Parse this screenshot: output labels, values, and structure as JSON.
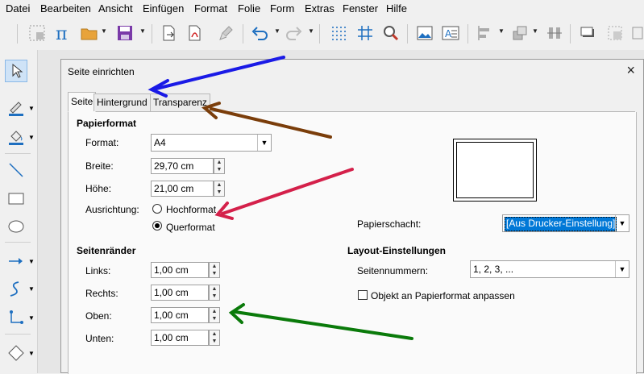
{
  "menu": [
    "Datei",
    "Bearbeiten",
    "Ansicht",
    "Einfügen",
    "Format",
    "Folie",
    "Form",
    "Extras",
    "Fenster",
    "Hilfe"
  ],
  "dialog": {
    "title": "Seite einrichten",
    "close": "×",
    "tabs": [
      "Seite",
      "Hintergrund",
      "Transparenz"
    ],
    "paper": {
      "heading": "Papierformat",
      "format_label": "Format:",
      "format_value": "A4",
      "width_label": "Breite:",
      "width_value": "29,70 cm",
      "height_label": "Höhe:",
      "height_value": "21,00 cm",
      "orientation_label": "Ausrichtung:",
      "portrait": "Hochformat",
      "landscape": "Querformat",
      "tray_label": "Papierschacht:",
      "tray_value": "[Aus Drucker-Einstellung]"
    },
    "margins": {
      "heading": "Seitenränder",
      "left_label": "Links:",
      "left_value": "1,00 cm",
      "right_label": "Rechts:",
      "right_value": "1,00 cm",
      "top_label": "Oben:",
      "top_value": "1,00 cm",
      "bottom_label": "Unten:",
      "bottom_value": "1,00 cm"
    },
    "layout": {
      "heading": "Layout-Einstellungen",
      "numbers_label": "Seitennummern:",
      "numbers_value": "1, 2, 3, ...",
      "fit_label": "Objekt an Papierformat anpassen"
    }
  },
  "icons": {
    "toolbar": [
      "grid-snap-icon",
      "pi-formula-icon",
      "open-folder-icon",
      "save-icon",
      "export-icon",
      "export-pdf-icon",
      "clone-format-icon",
      "undo-icon",
      "redo-icon",
      "display-grid-icon",
      "helplines-icon",
      "zoom-icon",
      "image-icon",
      "textbox-icon",
      "align-icon",
      "arrange-icon",
      "distribute-icon",
      "shadow-icon",
      "crop-icon"
    ],
    "sidebar": [
      "select-icon",
      "line-color-icon",
      "fill-color-icon",
      "line-icon",
      "rectangle-icon",
      "ellipse-icon",
      "arrow-line-icon",
      "curve-icon",
      "connector-icon",
      "diamond-icon"
    ]
  },
  "colors": {
    "blue_arrow": "#1a1ae6",
    "brown_arrow": "#7a3d0a",
    "red_arrow": "#d4204a",
    "green_arrow": "#0a7a0a",
    "selection": "#0078d7"
  }
}
